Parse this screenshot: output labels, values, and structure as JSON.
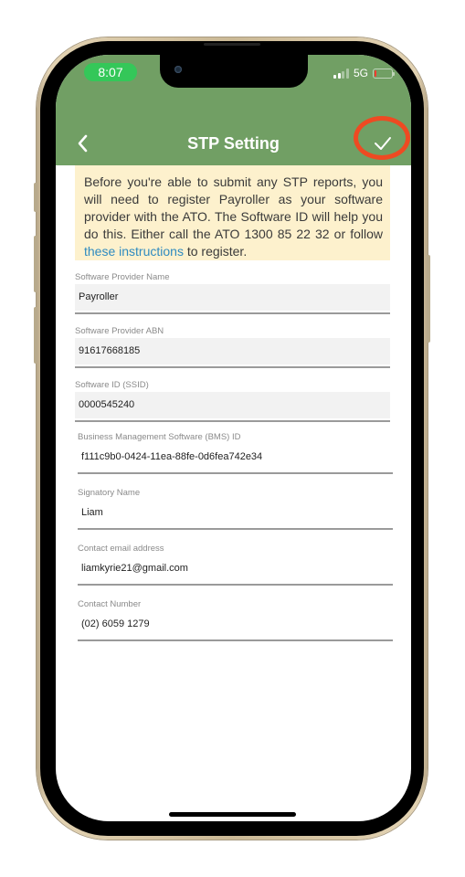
{
  "status_bar": {
    "time": "8:07",
    "network": "5G",
    "battery_level_percent": 5,
    "signal_bars_active": 2,
    "signal_bars_total": 4
  },
  "nav": {
    "title": "STP Setting",
    "back_icon": "chevron-left-icon",
    "save_icon": "checkmark-icon"
  },
  "notice": {
    "text_before_link": "Before you're able to submit any STP reports, you will need to register Payroller as your software provider with the ATO. The Software ID will help you do this. Either call the ATO 1300 85 22 32 or follow ",
    "link_text": "these instructions",
    "text_after_link": " to register."
  },
  "fields": [
    {
      "label": "Software Provider Name",
      "value": "Payroller"
    },
    {
      "label": "Software Provider ABN",
      "value": "91617668185"
    },
    {
      "label": "Software ID (SSID)",
      "value": "0000545240"
    },
    {
      "label": "Business Management Software (BMS) ID",
      "value": "f111c9b0-0424-11ea-88fe-0d6fea742e34"
    },
    {
      "label": "Signatory Name",
      "value": "Liam"
    },
    {
      "label": "Contact email address",
      "value": "liamkyrie21@gmail.com"
    },
    {
      "label": "Contact Number",
      "value": "(02) 6059 1279"
    }
  ],
  "colors": {
    "header_green": "#719f64",
    "notice_bg": "#fdf1cd",
    "link_blue": "#2f8bc0",
    "highlight_red": "#ee4a22",
    "time_pill_green": "#34c759"
  }
}
